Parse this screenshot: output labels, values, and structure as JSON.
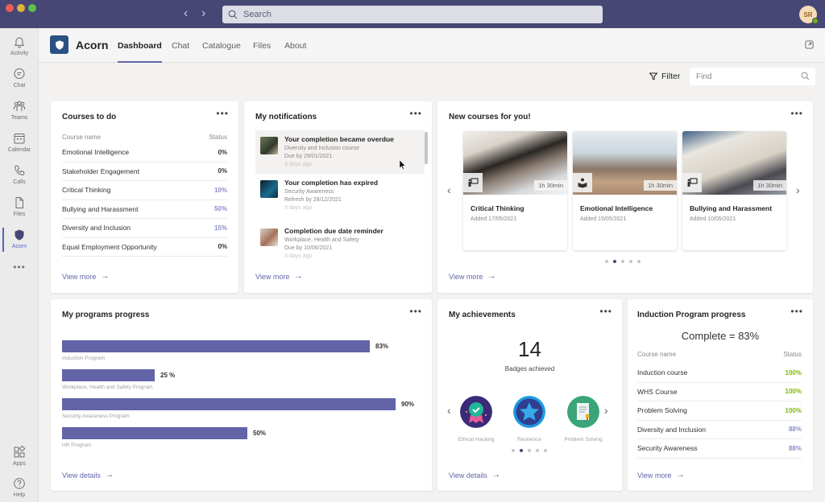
{
  "titlebar": {
    "search_placeholder": "Search",
    "avatar_initials": "SR",
    "presence_color": "#6bb700"
  },
  "rail": {
    "items": [
      {
        "label": "Activity",
        "icon": "bell-icon"
      },
      {
        "label": "Chat",
        "icon": "chat-icon"
      },
      {
        "label": "Teams",
        "icon": "teams-icon"
      },
      {
        "label": "Calendar",
        "icon": "calendar-icon"
      },
      {
        "label": "Calls",
        "icon": "phone-icon"
      },
      {
        "label": "Files",
        "icon": "file-icon"
      },
      {
        "label": "Acorn",
        "icon": "acorn-shield-icon",
        "active": true
      }
    ],
    "more_label": "•••",
    "bottom_items": [
      {
        "label": "Apps",
        "icon": "apps-icon"
      },
      {
        "label": "Help",
        "icon": "help-icon"
      }
    ]
  },
  "app": {
    "name": "Acorn",
    "tabs": [
      {
        "label": "Dashboard",
        "active": true
      },
      {
        "label": "Chat"
      },
      {
        "label": "Catalogue"
      },
      {
        "label": "Files"
      },
      {
        "label": "About"
      }
    ]
  },
  "toolbar": {
    "filter_label": "Filter",
    "find_placeholder": "Find"
  },
  "courses_todo": {
    "title": "Courses to do",
    "col_name": "Course name",
    "col_status": "Status",
    "rows": [
      {
        "name": "Emotional Intelligence",
        "status": "0%",
        "color": "#323130"
      },
      {
        "name": "Stakeholder Engagement",
        "status": "0%",
        "color": "#323130"
      },
      {
        "name": "Critical Thinking",
        "status": "10%",
        "color": "#8b8cc7"
      },
      {
        "name": "Bullying and Harassment",
        "status": "50%",
        "color": "#8b8cc7"
      },
      {
        "name": "Diversity and Inclusion",
        "status": "15%",
        "color": "#8b8cc7"
      },
      {
        "name": "Equal Employment Opportunity",
        "status": "0%",
        "color": "#323130"
      }
    ],
    "link": "View more"
  },
  "notifications": {
    "title": "My notifications",
    "items": [
      {
        "title": "Your completion became overdue",
        "subject": "Diversity and Inclusion course",
        "due": "Due by 29/01/2021",
        "ago": "3 days ago"
      },
      {
        "title": "Your completion has expired",
        "subject": "Security Awareness",
        "due": "Refresh by 28/12/2021",
        "ago": "3 days ago"
      },
      {
        "title": "Completion due date reminder",
        "subject": "Workplace, Health and Safety",
        "due": "Due by 10/06/2021",
        "ago": "3 days ago"
      }
    ],
    "link": "View more"
  },
  "new_courses": {
    "title": "New courses for you!",
    "courses": [
      {
        "name": "Critical Thinking",
        "added": "Added 17/05/2021",
        "duration": "1h 30min",
        "type": "presentation-icon"
      },
      {
        "name": "Emotional Intelligence",
        "added": "Added 15/05/2021",
        "duration": "1h 30min",
        "type": "reading-icon"
      },
      {
        "name": "Bullying and Harassment",
        "added": "Added 10/05/2021",
        "duration": "1h 30min",
        "type": "presentation-icon"
      }
    ],
    "page_count": 5,
    "active_page": 2,
    "link": "View more"
  },
  "programs": {
    "title": "My programs progress",
    "link": "View details",
    "accent": "#6264a7"
  },
  "chart_data": {
    "type": "bar",
    "orientation": "horizontal",
    "title": "My programs progress",
    "categories": [
      "Induction Program",
      "Workplace, Health and Safety Program",
      "Security Awareness Program",
      "HR Program"
    ],
    "values": [
      83,
      25,
      90,
      50
    ],
    "value_labels": [
      "83%",
      "25 %",
      "90%",
      "50%"
    ],
    "xlim": [
      0,
      100
    ],
    "unit": "%",
    "grid": false
  },
  "achievements": {
    "title": "My achievements",
    "count": "14",
    "count_label": "Badges achieved",
    "badges": [
      {
        "label": "Ethical Hacking",
        "icon": "ribbon-check-icon"
      },
      {
        "label": "Resilience",
        "icon": "star-icon"
      },
      {
        "label": "Problem Solving",
        "icon": "certificate-icon"
      }
    ],
    "page_count": 5,
    "active_page": 2,
    "link": "View details"
  },
  "induction": {
    "title": "Induction Program progress",
    "complete": "Complete = 83%",
    "col_name": "Course name",
    "col_status": "Status",
    "rows": [
      {
        "name": "Induction course",
        "status": "100%",
        "color": "#7fba00"
      },
      {
        "name": "WHS Course",
        "status": "100%",
        "color": "#7fba00"
      },
      {
        "name": "Problem Solving",
        "status": "100%",
        "color": "#7fba00"
      },
      {
        "name": "Diversity and Inclusion",
        "status": "88%",
        "color": "#8b8cc7"
      },
      {
        "name": "Security Awareness",
        "status": "88%",
        "color": "#8b8cc7"
      }
    ],
    "link": "View more"
  }
}
